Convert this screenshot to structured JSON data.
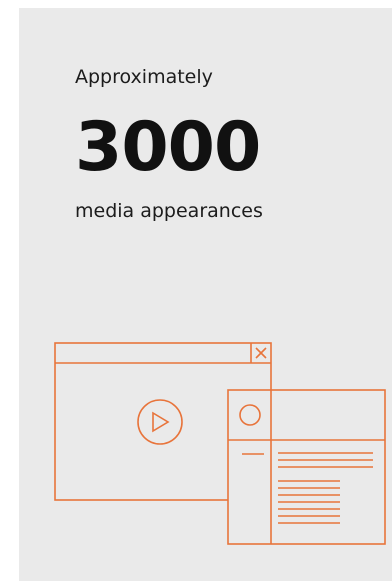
{
  "stat": {
    "intro": "Approximately",
    "number": "3000",
    "caption": "media appearances"
  },
  "illustration": {
    "icons": [
      "browser-window-icon",
      "close-icon",
      "play-icon",
      "profile-window-icon",
      "avatar-icon",
      "text-lines-icon"
    ]
  },
  "colors": {
    "card_background": "#eaeaea",
    "text": "#1c1c1c",
    "accent_orange": "#e8743b"
  }
}
